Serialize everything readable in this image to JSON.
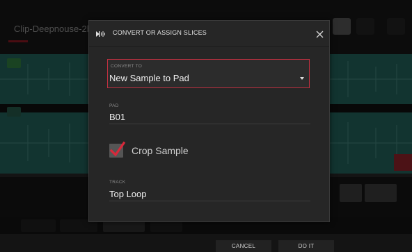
{
  "background_app": {
    "title": "Clip-Deepnouse-2b"
  },
  "dialog": {
    "title": "CONVERT OR ASSIGN SLICES",
    "icon": "slice-icon",
    "close_icon": "close-icon",
    "convert_to": {
      "label": "CONVERT TO",
      "value": "New Sample to Pad"
    },
    "pad": {
      "label": "PAD",
      "value": "B01"
    },
    "crop_sample": {
      "label": "Crop Sample",
      "checked": true
    },
    "track": {
      "label": "TRACK",
      "value": "Top Loop"
    }
  },
  "footer": {
    "cancel_label": "CANCEL",
    "do_it_label": "DO IT"
  },
  "colors": {
    "accent": "#c03040",
    "dialog_bg": "#262626",
    "wave_bg": "#2a7c73"
  }
}
